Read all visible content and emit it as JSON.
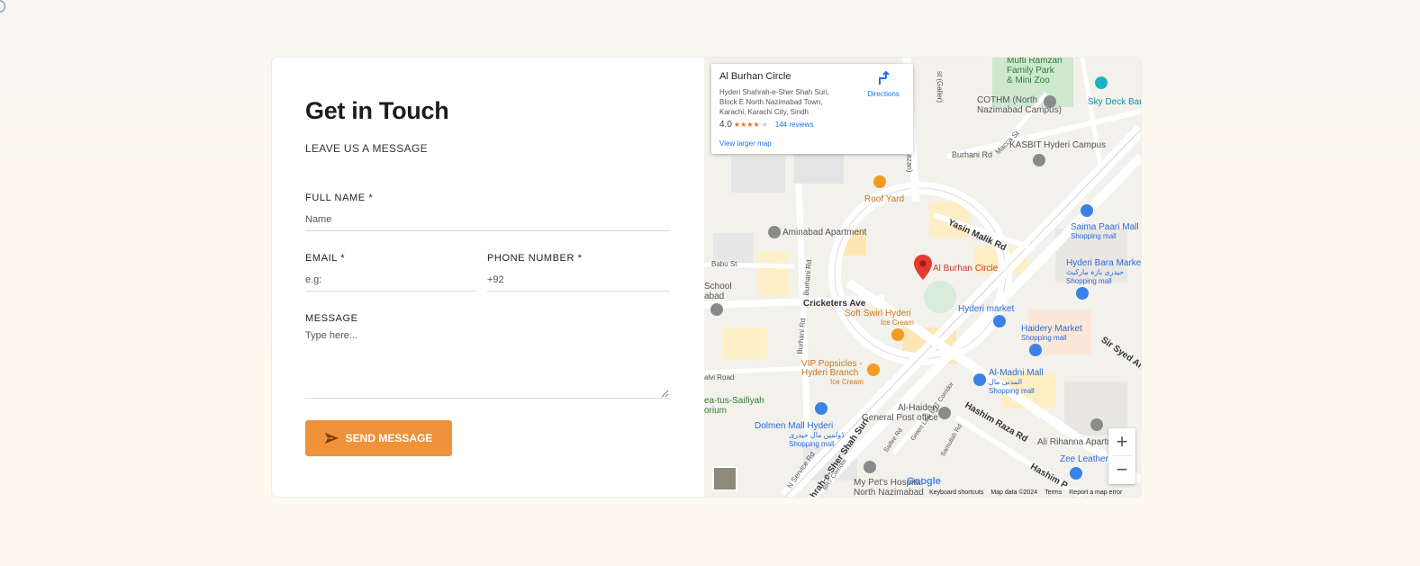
{
  "contact": {
    "title": "Get in Touch",
    "subtitle": "LEAVE US A MESSAGE",
    "full_name_label": "FULL NAME *",
    "full_name_placeholder": "Name",
    "email_label": "EMAIL *",
    "email_placeholder": "e.g:",
    "phone_label": "PHONE NUMBER *",
    "phone_placeholder": "+92",
    "message_label": "MESSAGE",
    "message_placeholder": "Type here...",
    "send_label": "SEND MESSAGE",
    "accent_color": "#f0923a"
  },
  "map": {
    "place_name": "Al Burhan Circle",
    "address_line1": "Hyderi Shahrah-e-Sher Shah Suri,",
    "address_line2": "Block E North Nazimabad Town,",
    "address_line3": "Karachi, Karachi City, Sindh",
    "rating": "4.0",
    "stars": "★★★★",
    "star_empty": "★",
    "reviews": "144 reviews",
    "directions": "Directions",
    "view_larger": "View larger map",
    "zoom_in": "+",
    "zoom_out": "−",
    "logo": "Google",
    "attribution": {
      "shortcuts": "Keyboard shortcuts",
      "data": "Map data ©2024",
      "terms": "Terms",
      "report": "Report a map error"
    },
    "labels": {
      "mufti_ramzan": "Mufti Ramzan",
      "family_park": "Family Park",
      "mini_zoo": "& Mini Zoo",
      "cothm": "COTHM (North",
      "cothm2": "Nazimabad Campus)",
      "sky_deck": "Sky Deck Bar",
      "kasbit": "KASBIT Hyderi Campus",
      "burhani_rd_top": "Burhani Rd",
      "macca_st": "Macca St",
      "roof_yard": "Roof Yard",
      "aminabad": "Aminabad Apartment",
      "yasin_malik": "Yasin Malik Rd",
      "saima_paari": "Saima Paari Mall",
      "shopping_mall_1": "Shopping mall",
      "babu_st": "Babu St",
      "school": "School",
      "abad": "abad",
      "burhani_rd_left": "Burhani Rd",
      "al_burhan_circle": "Al Burhan Circle",
      "hyderi_bara": "Hyderi Bara Market",
      "hyderi_bara_urdu": "حیدری بازہ مارکیٹ",
      "shopping_mall_2": "Shopping mall",
      "cricketers_ave": "Cricketers Ave",
      "hyderi_market": "Hyderi market",
      "soft_swirl": "Soft Swirl Hyderi",
      "ice_cream_1": "Ice Cream",
      "haidery_market": "Haidery Market",
      "shopping_mall_3": "Shopping mall",
      "burhani_rd_mid": "Burhani Rd",
      "vip_popsicles": "VIP Popsicles -",
      "hyderi_branch": "Hyderi Branch",
      "ice_cream_2": "Ice Cream",
      "sir_syed": "Sir Syed Ahm",
      "alvi_road": "alvi Road",
      "al_madni": "Al-Madni Mall",
      "al_madni_urdu": "المدنی مال",
      "shopping_mall_4": "Shopping mall",
      "green_line": "Green Line BRT Corridor",
      "ea_tus": "ea-tus-Saifiyah",
      "orium": "orium",
      "al_haidery": "Al-Haidery",
      "general_post": "General Post office",
      "hashim_raza": "Hashim Raza Rd",
      "dolmen_mall": "Dolmen Mall Hyderi",
      "dolmen_urdu": "ڈولمین مال حیدری",
      "shopping_mall_5": "Shopping mall",
      "ali_rihanna": "Ali Rihanna Apartment",
      "zee_leather": "Zee Leather",
      "n_service_rd": "N Service Rd",
      "sher_shah": "hrah-e-Sher Shah Suri",
      "brt_corridor": "BRT Corridor",
      "saifee_rd": "Saifee Rd",
      "samullah_rd": "Samullah Rd",
      "hashim_p": "Hashim P",
      "my_pets": "My Pet's Hospital",
      "north_nazimabad": "North Nazimabad",
      "galleria": "st (Galler)",
      "azan": "azan)"
    }
  }
}
